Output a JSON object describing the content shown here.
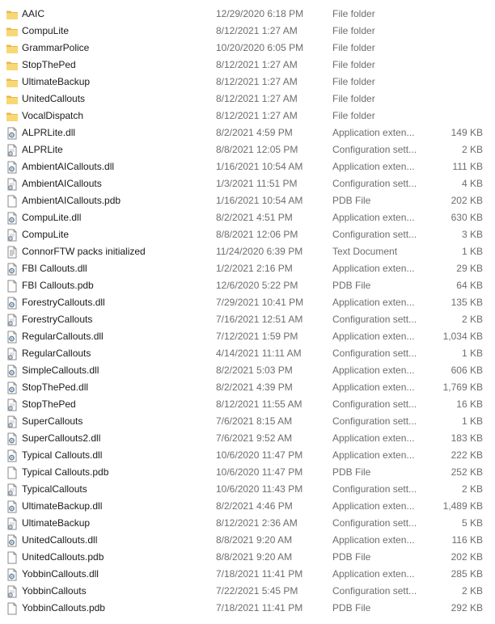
{
  "files": [
    {
      "name": "AAIC",
      "date": "12/29/2020 6:18 PM",
      "type": "File folder",
      "size": "",
      "icon": "folder-icon"
    },
    {
      "name": "CompuLite",
      "date": "8/12/2021 1:27 AM",
      "type": "File folder",
      "size": "",
      "icon": "folder-icon"
    },
    {
      "name": "GrammarPolice",
      "date": "10/20/2020 6:05 PM",
      "type": "File folder",
      "size": "",
      "icon": "folder-icon"
    },
    {
      "name": "StopThePed",
      "date": "8/12/2021 1:27 AM",
      "type": "File folder",
      "size": "",
      "icon": "folder-icon"
    },
    {
      "name": "UltimateBackup",
      "date": "8/12/2021 1:27 AM",
      "type": "File folder",
      "size": "",
      "icon": "folder-icon"
    },
    {
      "name": "UnitedCallouts",
      "date": "8/12/2021 1:27 AM",
      "type": "File folder",
      "size": "",
      "icon": "folder-icon"
    },
    {
      "name": "VocalDispatch",
      "date": "8/12/2021 1:27 AM",
      "type": "File folder",
      "size": "",
      "icon": "folder-icon"
    },
    {
      "name": "ALPRLite.dll",
      "date": "8/2/2021 4:59 PM",
      "type": "Application exten...",
      "size": "149 KB",
      "icon": "dll-icon"
    },
    {
      "name": "ALPRLite",
      "date": "8/8/2021 12:05 PM",
      "type": "Configuration sett...",
      "size": "2 KB",
      "icon": "config-icon"
    },
    {
      "name": "AmbientAICallouts.dll",
      "date": "1/16/2021 10:54 AM",
      "type": "Application exten...",
      "size": "111 KB",
      "icon": "dll-icon"
    },
    {
      "name": "AmbientAICallouts",
      "date": "1/3/2021 11:51 PM",
      "type": "Configuration sett...",
      "size": "4 KB",
      "icon": "config-icon"
    },
    {
      "name": "AmbientAICallouts.pdb",
      "date": "1/16/2021 10:54 AM",
      "type": "PDB File",
      "size": "202 KB",
      "icon": "file-icon"
    },
    {
      "name": "CompuLite.dll",
      "date": "8/2/2021 4:51 PM",
      "type": "Application exten...",
      "size": "630 KB",
      "icon": "dll-icon"
    },
    {
      "name": "CompuLite",
      "date": "8/8/2021 12:06 PM",
      "type": "Configuration sett...",
      "size": "3 KB",
      "icon": "config-icon"
    },
    {
      "name": "ConnorFTW packs initialized",
      "date": "11/24/2020 6:39 PM",
      "type": "Text Document",
      "size": "1 KB",
      "icon": "text-document-icon"
    },
    {
      "name": "FBI Callouts.dll",
      "date": "1/2/2021 2:16 PM",
      "type": "Application exten...",
      "size": "29 KB",
      "icon": "dll-icon"
    },
    {
      "name": "FBI Callouts.pdb",
      "date": "12/6/2020 5:22 PM",
      "type": "PDB File",
      "size": "64 KB",
      "icon": "file-icon"
    },
    {
      "name": "ForestryCallouts.dll",
      "date": "7/29/2021 10:41 PM",
      "type": "Application exten...",
      "size": "135 KB",
      "icon": "dll-icon"
    },
    {
      "name": "ForestryCallouts",
      "date": "7/16/2021 12:51 AM",
      "type": "Configuration sett...",
      "size": "2 KB",
      "icon": "config-icon"
    },
    {
      "name": "RegularCallouts.dll",
      "date": "7/12/2021 1:59 PM",
      "type": "Application exten...",
      "size": "1,034 KB",
      "icon": "dll-icon"
    },
    {
      "name": "RegularCallouts",
      "date": "4/14/2021 11:11 AM",
      "type": "Configuration sett...",
      "size": "1 KB",
      "icon": "config-icon"
    },
    {
      "name": "SimpleCallouts.dll",
      "date": "8/2/2021 5:03 PM",
      "type": "Application exten...",
      "size": "606 KB",
      "icon": "dll-icon"
    },
    {
      "name": "StopThePed.dll",
      "date": "8/2/2021 4:39 PM",
      "type": "Application exten...",
      "size": "1,769 KB",
      "icon": "dll-icon"
    },
    {
      "name": "StopThePed",
      "date": "8/12/2021 11:55 AM",
      "type": "Configuration sett...",
      "size": "16 KB",
      "icon": "config-icon"
    },
    {
      "name": "SuperCallouts",
      "date": "7/6/2021 8:15 AM",
      "type": "Configuration sett...",
      "size": "1 KB",
      "icon": "config-icon"
    },
    {
      "name": "SuperCallouts2.dll",
      "date": "7/6/2021 9:52 AM",
      "type": "Application exten...",
      "size": "183 KB",
      "icon": "dll-icon"
    },
    {
      "name": "Typical Callouts.dll",
      "date": "10/6/2020 11:47 PM",
      "type": "Application exten...",
      "size": "222 KB",
      "icon": "dll-icon"
    },
    {
      "name": "Typical Callouts.pdb",
      "date": "10/6/2020 11:47 PM",
      "type": "PDB File",
      "size": "252 KB",
      "icon": "file-icon"
    },
    {
      "name": "TypicalCallouts",
      "date": "10/6/2020 11:43 PM",
      "type": "Configuration sett...",
      "size": "2 KB",
      "icon": "config-icon"
    },
    {
      "name": "UltimateBackup.dll",
      "date": "8/2/2021 4:46 PM",
      "type": "Application exten...",
      "size": "1,489 KB",
      "icon": "dll-icon"
    },
    {
      "name": "UltimateBackup",
      "date": "8/12/2021 2:36 AM",
      "type": "Configuration sett...",
      "size": "5 KB",
      "icon": "config-icon"
    },
    {
      "name": "UnitedCallouts.dll",
      "date": "8/8/2021 9:20 AM",
      "type": "Application exten...",
      "size": "116 KB",
      "icon": "dll-icon"
    },
    {
      "name": "UnitedCallouts.pdb",
      "date": "8/8/2021 9:20 AM",
      "type": "PDB File",
      "size": "202 KB",
      "icon": "file-icon"
    },
    {
      "name": "YobbinCallouts.dll",
      "date": "7/18/2021 11:41 PM",
      "type": "Application exten...",
      "size": "285 KB",
      "icon": "dll-icon"
    },
    {
      "name": "YobbinCallouts",
      "date": "7/22/2021 5:45 PM",
      "type": "Configuration sett...",
      "size": "2 KB",
      "icon": "config-icon"
    },
    {
      "name": "YobbinCallouts.pdb",
      "date": "7/18/2021 11:41 PM",
      "type": "PDB File",
      "size": "292 KB",
      "icon": "file-icon"
    }
  ],
  "colors": {
    "folder": "#f8d775",
    "folder_dark": "#e8b84a",
    "text": "#1a1a1a",
    "secondary_text": "#6d6d6d",
    "gear": "#7a8ea6"
  }
}
